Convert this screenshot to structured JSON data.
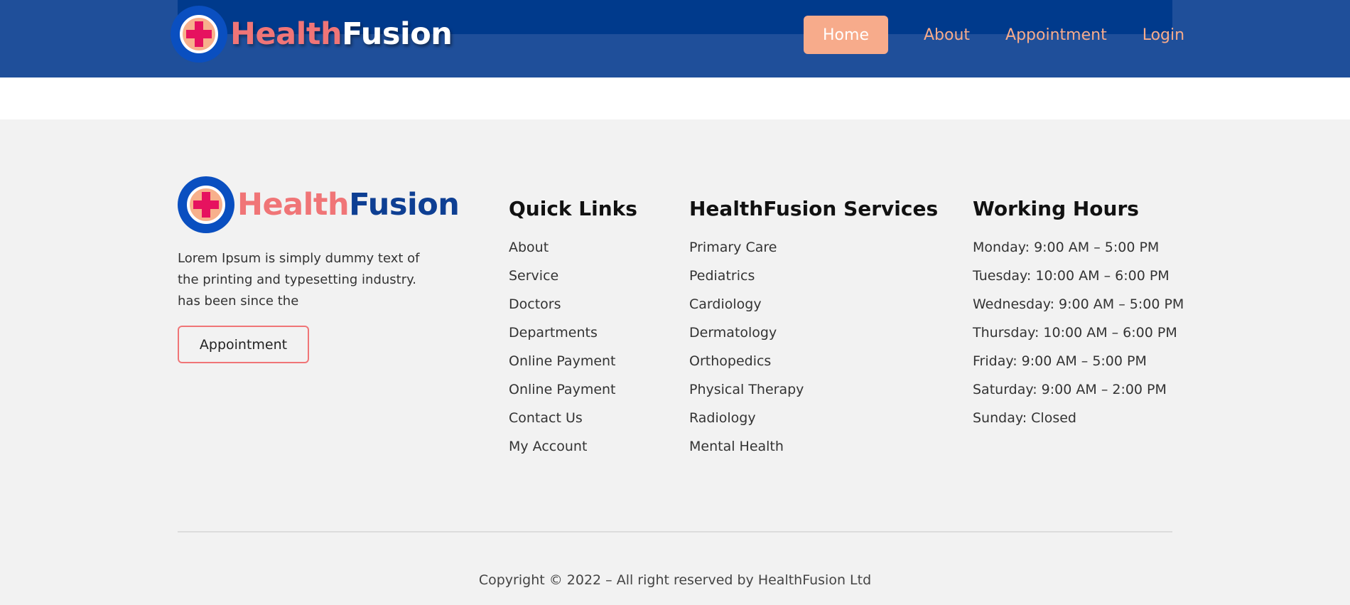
{
  "header": {
    "logo": {
      "part1": "Health",
      "part2": "Fusion",
      "icon": "medical-cross-icon"
    },
    "nav": [
      {
        "label": "Home",
        "active": true
      },
      {
        "label": "About"
      },
      {
        "label": "Appointment"
      },
      {
        "label": "Login"
      }
    ]
  },
  "footer": {
    "logo": {
      "part1": "Health",
      "part2": "Fusion",
      "icon": "medical-cross-icon"
    },
    "description_lines": [
      "Lorem Ipsum is simply dummy text of",
      "the printing and typesetting industry.",
      "has been since the"
    ],
    "appointment_button": "Appointment",
    "quick_links": {
      "title": "Quick Links",
      "items": [
        "About",
        "Service",
        "Doctors",
        "Departments",
        "Online Payment",
        "Online Payment",
        "Contact Us",
        "My Account"
      ]
    },
    "services": {
      "title": "HealthFusion Services",
      "items": [
        "Primary Care",
        "Pediatrics",
        "Cardiology",
        "Dermatology",
        "Orthopedics",
        "Physical Therapy",
        "Radiology",
        "Mental Health"
      ]
    },
    "hours": {
      "title": "Working Hours",
      "items": [
        "Monday: 9:00 AM – 5:00 PM",
        "Tuesday: 10:00 AM – 6:00 PM",
        "Wednesday: 9:00 AM – 5:00 PM",
        "Thursday: 10:00 AM – 6:00 PM",
        "Friday: 9:00 AM – 5:00 PM",
        "Saturday: 9:00 AM – 2:00 PM",
        "Sunday: Closed"
      ]
    },
    "copyright": "Copyright © 2022 – All right reserved by HealthFusion Ltd"
  },
  "colors": {
    "header_bg": "#1f4f9a",
    "header_band": "#003a8c",
    "accent": "#f7ab8b",
    "brand_red": "#f07577",
    "brand_blue": "#0e3f93",
    "footer_bg": "#f2f2f2"
  }
}
